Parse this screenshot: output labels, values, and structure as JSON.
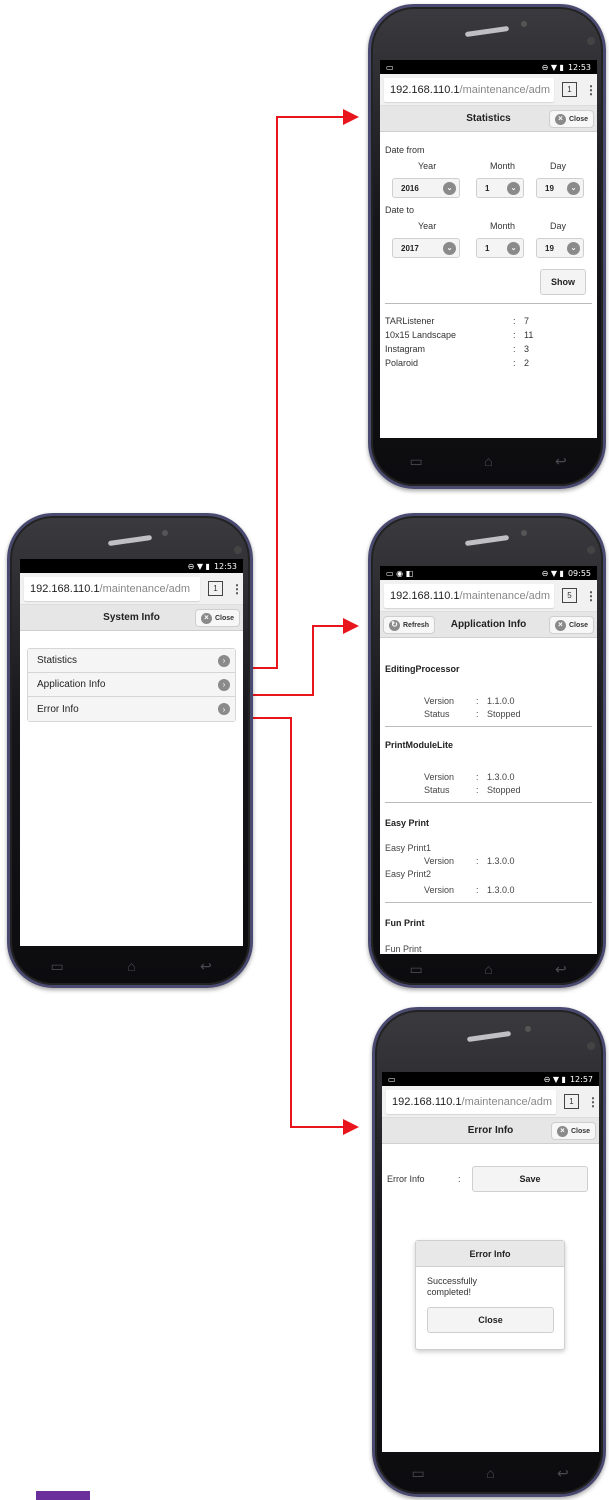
{
  "colors": {
    "arrow": "#e8151c",
    "footer_bar": "#6b2f9c",
    "header_bg": "#e6e6e6",
    "phone_frame": "#4a4a70"
  },
  "main_phone": {
    "status_time": "12:53",
    "url_host": "192.168.110.1",
    "url_path": "/maintenance/adm",
    "tab_count": "1",
    "header_title": "System Info",
    "close_label": "Close",
    "items": [
      {
        "label": "Statistics"
      },
      {
        "label": "Application Info"
      },
      {
        "label": "Error Info"
      }
    ]
  },
  "stats_phone": {
    "status_time": "12:53",
    "url_host": "192.168.110.1",
    "url_path": "/maintenance/adm",
    "tab_count": "1",
    "header_title": "Statistics",
    "close_label": "Close",
    "date_from_label": "Date from",
    "date_to_label": "Date to",
    "col_year": "Year",
    "col_month": "Month",
    "col_day": "Day",
    "from": {
      "year": "2016",
      "month": "1",
      "day": "19"
    },
    "to": {
      "year": "2017",
      "month": "1",
      "day": "19"
    },
    "show_label": "Show",
    "rows": [
      {
        "name": "TARListener",
        "sep": ":",
        "value": "7"
      },
      {
        "name": "10x15 Landscape",
        "sep": ":",
        "value": "11"
      },
      {
        "name": "Instagram",
        "sep": ":",
        "value": "3"
      },
      {
        "name": "Polaroid",
        "sep": ":",
        "value": "2"
      }
    ]
  },
  "app_phone": {
    "status_time": "09:55",
    "url_host": "192.168.110.1",
    "url_path": "/maintenance/adm",
    "tab_count": "5",
    "refresh_label": "Refresh",
    "header_title": "Application Info",
    "close_label": "Close",
    "version_label": "Version",
    "status_label": "Status",
    "sep": ":",
    "sections": {
      "s1": {
        "title": "EditingProcessor",
        "version": "1.1.0.0",
        "status": "Stopped"
      },
      "s2": {
        "title": "PrintModuleLite",
        "version": "1.3.0.0",
        "status": "Stopped"
      },
      "s3": {
        "title": "Easy Print",
        "sub1": "Easy Print1",
        "version1": "1.3.0.0",
        "sub2": "Easy Print2",
        "version2": "1.3.0.0"
      },
      "s4": {
        "title": "Fun Print",
        "sub1": "Fun Print"
      }
    }
  },
  "error_phone": {
    "status_time": "12:57",
    "url_host": "192.168.110.1",
    "url_path": "/maintenance/adm",
    "tab_count": "1",
    "header_title": "Error Info",
    "close_label": "Close",
    "row_label": "Error Info",
    "sep": ":",
    "save_label": "Save",
    "dialog_title": "Error Info",
    "dialog_message": "Successfully completed!",
    "dialog_close": "Close"
  }
}
